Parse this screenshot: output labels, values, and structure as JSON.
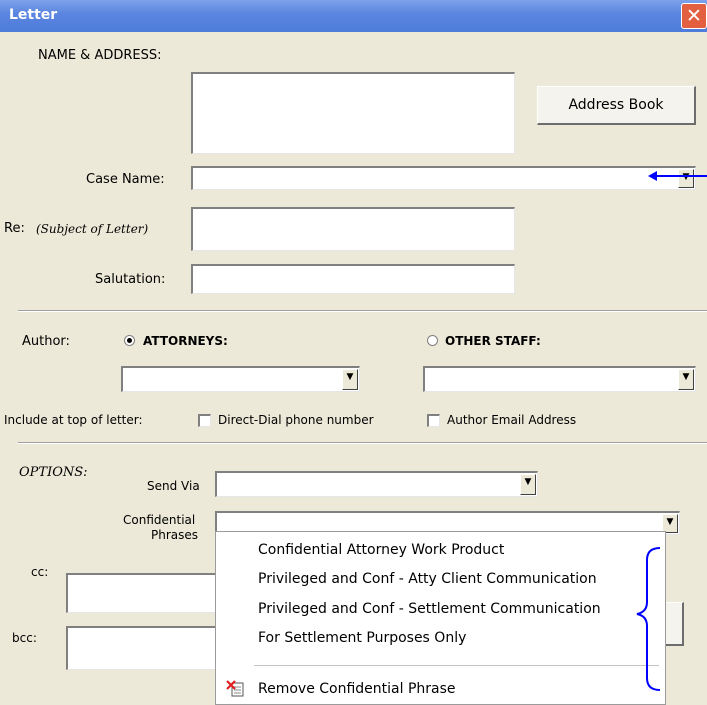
{
  "window": {
    "title": "Letter",
    "close_glyph": "✕"
  },
  "fields": {
    "name_address_label": "NAME & ADDRESS:",
    "address_book_button": "Address Book",
    "case_name_label": "Case Name:",
    "re_label": "Re:",
    "re_hint": "(Subject of Letter)",
    "salutation_label": "Salutation:"
  },
  "author": {
    "label": "Author:",
    "attorneys_label": "ATTORNEYS:",
    "attorneys_selected": true,
    "other_staff_label": "OTHER STAFF:",
    "other_staff_selected": false,
    "include_label": "Include at top of letter:",
    "direct_dial_label": "Direct-Dial phone number",
    "direct_dial_checked": false,
    "author_email_label": "Author Email Address",
    "author_email_checked": false
  },
  "options": {
    "options_label": "OPTIONS:",
    "send_via_label": "Send Via",
    "confidential_label_line1": "Confidential",
    "confidential_label_line2": "Phrases",
    "cc_label": "cc:",
    "bcc_label": "bcc:"
  },
  "dropdown_menu": {
    "items": [
      "Confidential Attorney Work Product",
      "Privileged and Conf - Atty Client Communication",
      "Privileged and Conf - Settlement Communication",
      "For Settlement Purposes Only"
    ],
    "remove_item": "Remove Confidential Phrase",
    "remove_icon": "remove-document-icon"
  },
  "annotation_colors": {
    "arrow": "#0000ff",
    "brace": "#0000ff"
  },
  "dropdown_arrow_glyph": "▼"
}
